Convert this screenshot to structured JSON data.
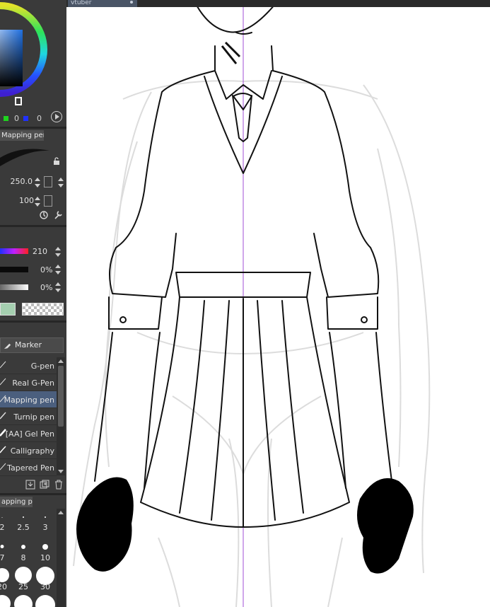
{
  "document": {
    "tab_title": "vtuber"
  },
  "color": {
    "rgb_values": [
      "0",
      "0"
    ],
    "hue_value": "210",
    "sat_value": "0%",
    "bright_value": "0%",
    "fill_color": "#a5cfb0"
  },
  "tool_property": {
    "tab_label": "Mapping pen]",
    "brush_size": "250.0",
    "opacity": "100"
  },
  "sub_tool": {
    "group_button": "Marker",
    "brushes": [
      {
        "name": "G-pen"
      },
      {
        "name": "Real G-Pen"
      },
      {
        "name": "Mapping pen"
      },
      {
        "name": "Turnip pen"
      },
      {
        "name": "[AA] Gel Pen"
      },
      {
        "name": "Calligraphy"
      },
      {
        "name": "Tapered Pen"
      }
    ],
    "selected_index": 2
  },
  "brush_size_panel": {
    "tab_label": "apping pen]",
    "sizes": [
      "2",
      "2.5",
      "3",
      "7",
      "8",
      "10",
      "20",
      "25",
      "30"
    ]
  },
  "icons": {
    "lock": "lock-icon",
    "rotate": "rotate-icon",
    "wrench": "wrench-icon",
    "marker": "marker-icon"
  }
}
